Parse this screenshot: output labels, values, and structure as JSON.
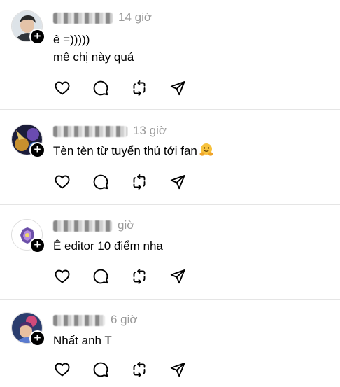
{
  "posts": [
    {
      "time": "14 giờ",
      "lines": [
        "ê =)))))",
        "mê chị này quá"
      ],
      "follow_symbol": "+"
    },
    {
      "time": "13 giờ",
      "lines": [
        "Tèn tèn từ tuyển thủ tới fan"
      ],
      "follow_symbol": "+"
    },
    {
      "time": "giờ",
      "lines": [
        "Ê editor 10 điểm nha"
      ],
      "follow_symbol": "+"
    },
    {
      "time": "6 giờ",
      "lines": [
        "Nhất anh T"
      ],
      "follow_symbol": "+"
    }
  ],
  "icons": {
    "like": "heart-icon",
    "reply": "comment-icon",
    "repost": "repost-icon",
    "share": "send-icon"
  }
}
